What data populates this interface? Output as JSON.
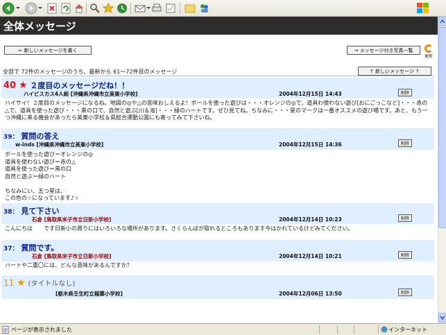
{
  "page": {
    "title": "全体メッセージ",
    "new_message_button": "← 新しいメッセージを書く",
    "photo_list_button": "→ メッセージ付き写真一覧",
    "reload_label": "更新",
    "summary": "全部で 72件のメッセージのうち、最新から 61～72件目のメッセージ",
    "newer_messages_button": "↑ 新しいメッセージ ↑",
    "delete_label": "削除"
  },
  "messages": [
    {
      "number": "40",
      "title": "２度目のメッセージだね！！",
      "author": "ハイビスカス4人組 [沖縄県沖縄市立美東小学校]",
      "date": "2004年12月15日 14:43",
      "body": "ハイサイ！２度目のメッセージになるね。地図の◎や△の意味おしえるよ！ボールを使った遊びは・・・オレンジの◎で、道具わ使わない遊び[おにごっこなど]・・・赤の△で、道具を使った遊び・・・黒の口で、自然と遊ぶ[川＆海]・・・緑のハートです。ぜひ見てね。ちなみに・・・星のマークは一番オススメの遊び場です。あと、もう一つ沖縄に来る機会があったら美東小学校＆県総合運動公園にも寄ってみて下さいね。"
    },
    {
      "number": "39：",
      "title": "質問の答え",
      "author": "w-inds [沖縄県沖縄市立美東小学校]",
      "date": "2004年12月15日 14:36",
      "body": "ボールを使った遊び＝オレンジの◎\n道具を使わない遊び＝赤の△\n道具を使った遊び＝黒の口\n自然と遊ぶ＝緑のハート\n\nちなみにい、五つ星は、\nこの色の☆になっています♪☆"
    },
    {
      "number": "38：",
      "title": "見て下さい",
      "author": "石倉 [鳥取県米子市立日新小学校]",
      "date": "2004年12月14日 10:23",
      "body": "こんにちは　　です日新小の周りにはいろいろな場所があります。さくらんぼが取れるところもあります今はかれているけどみてください。"
    },
    {
      "number": "37：",
      "title": "質問です。",
      "author": "石倉 [鳥取県米子市立日新小学校]",
      "date": "2004年12月14日 10:21",
      "body": "ハートや二重〇には、どんな意味があるんですか？"
    },
    {
      "number": "11",
      "title": "(タイトルなし)",
      "author": "[栃木県壬生町立稲葉小学校]",
      "date": "2004年12月06日 13:50",
      "body": ""
    }
  ],
  "statusbar": {
    "status": "ページが表示されました",
    "zone": "インターネット"
  },
  "colors": {
    "header_bg": "#2d2d2d",
    "message_header_bg": "#dfefff",
    "title_blue": "#0a1e8c",
    "accent_red": "#e31414",
    "accent_orange": "#e8930b",
    "author_red": "#a30000"
  },
  "icons": [
    "back-icon",
    "forward-icon",
    "stop-icon",
    "refresh-icon",
    "home-icon",
    "search-icon",
    "favorites-icon",
    "history-icon",
    "mail-icon",
    "print-icon",
    "edit-icon",
    "folder-icon",
    "messenger-icon",
    "windows-logo-icon",
    "reload-icon",
    "star-icon",
    "page-icon",
    "globe-icon"
  ]
}
